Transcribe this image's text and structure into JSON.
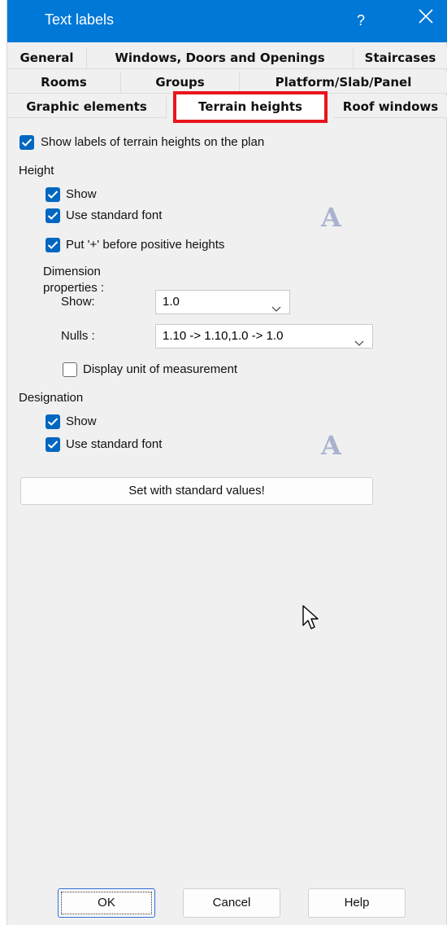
{
  "window": {
    "title": "Text labels",
    "help_glyph": "?",
    "close_icon": "close-icon",
    "titlebar_color": "#0078d7"
  },
  "tabs": {
    "row1": [
      "General",
      "Windows, Doors and Openings",
      "Staircases"
    ],
    "row2": [
      "Rooms",
      "Groups",
      "Platform/Slab/Panel"
    ],
    "row3": [
      "Graphic elements",
      "Terrain heights",
      "Roof windows"
    ],
    "active": "Terrain heights",
    "highlight_color": "#e8141b"
  },
  "main": {
    "show_labels": {
      "label": "Show labels of terrain heights on the plan",
      "checked": true
    },
    "height": {
      "heading": "Height",
      "show": {
        "label": "Show",
        "checked": true
      },
      "use_standard_font": {
        "label": "Use standard font",
        "checked": true
      },
      "font_icon": "A",
      "put_plus": {
        "label": "Put '+' before positive heights",
        "checked": true
      },
      "dimension_heading_line1": "Dimension",
      "dimension_heading_line2": "properties :",
      "show_select": {
        "label": "Show:",
        "value": "1.0"
      },
      "nulls_select": {
        "label": "Nulls :",
        "value": "1.10 -> 1.10,1.0 -> 1.0"
      },
      "display_unit": {
        "label": "Display unit of measurement",
        "checked": false
      }
    },
    "designation": {
      "heading": "Designation",
      "show": {
        "label": "Show",
        "checked": true
      },
      "use_standard_font": {
        "label": "Use standard font",
        "checked": true
      },
      "font_icon": "A"
    },
    "set_standard_label": "Set with standard values!"
  },
  "footer": {
    "ok_label": "OK",
    "cancel_label": "Cancel",
    "help_label": "Help"
  },
  "colors": {
    "checkbox_blue": "#0067c0",
    "dialog_bg": "#f0f0f0"
  }
}
